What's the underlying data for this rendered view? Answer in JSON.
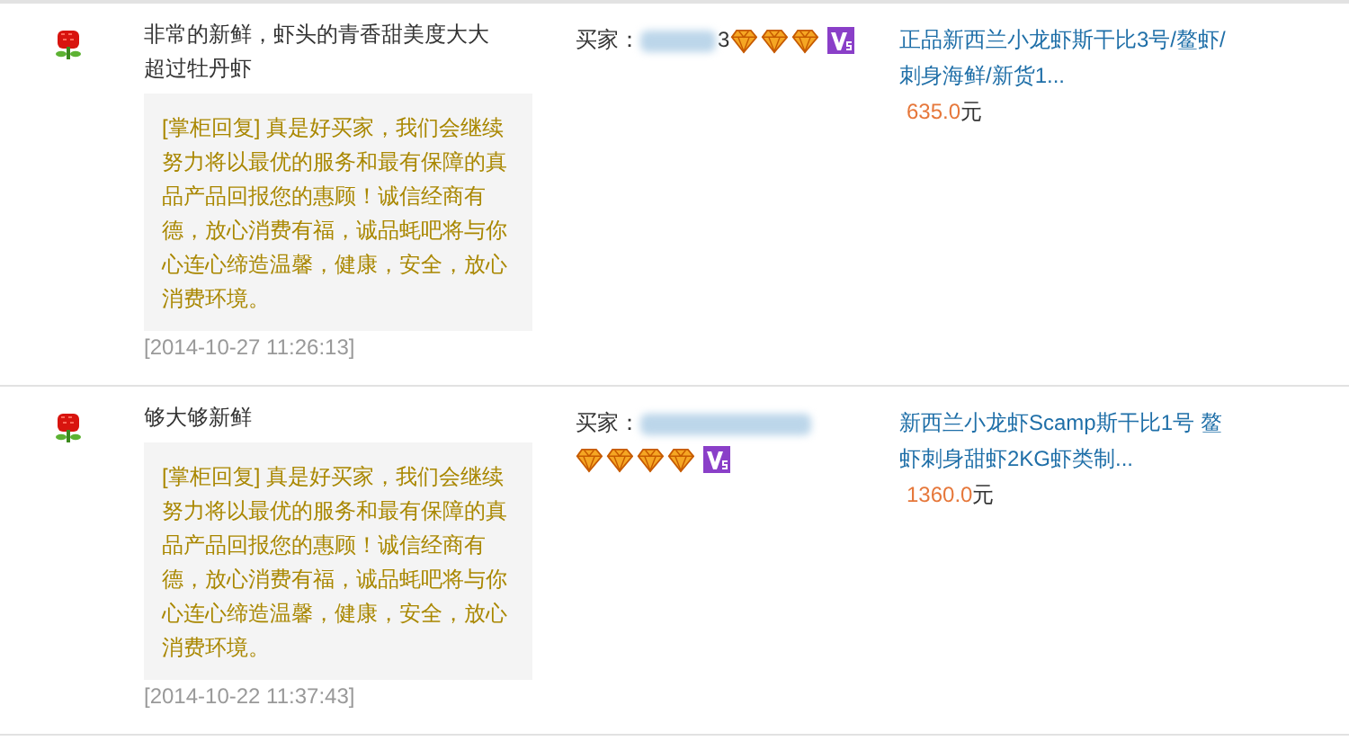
{
  "reviews": [
    {
      "comment": "非常的新鲜，虾头的青香甜美度大大超过牡丹虾",
      "reply": "[掌柜回复] 真是好买家，我们会继续努力将以最优的服务和最有保障的真品产品回报您的惠顾！诚信经商有德，放心消费有福，诚品蚝吧将与你心连心缔造温馨，健康，安全，放心消费环境。",
      "time": "[2014-10-27 11:26:13]",
      "buyer_label": "买家：",
      "buyer_name": "3",
      "stars": 3,
      "vip": true,
      "product": "正品新西兰小龙虾斯干比3号/鳌虾/刺身海鲜/新货1...",
      "price": "635.0",
      "currency": "元"
    },
    {
      "comment": "够大够新鲜",
      "reply": "[掌柜回复] 真是好买家，我们会继续努力将以最优的服务和最有保障的真品产品回报您的惠顾！诚信经商有德，放心消费有福，诚品蚝吧将与你心连心缔造温馨，健康，安全，放心消费环境。",
      "time": "[2014-10-22 11:37:43]",
      "buyer_label": "买家：",
      "stars": 4,
      "vip": true,
      "product": "新西兰小龙虾Scamp斯干比1号 鳌虾刺身甜虾2KG虾类制...",
      "price": "1360.0",
      "currency": "元"
    }
  ]
}
